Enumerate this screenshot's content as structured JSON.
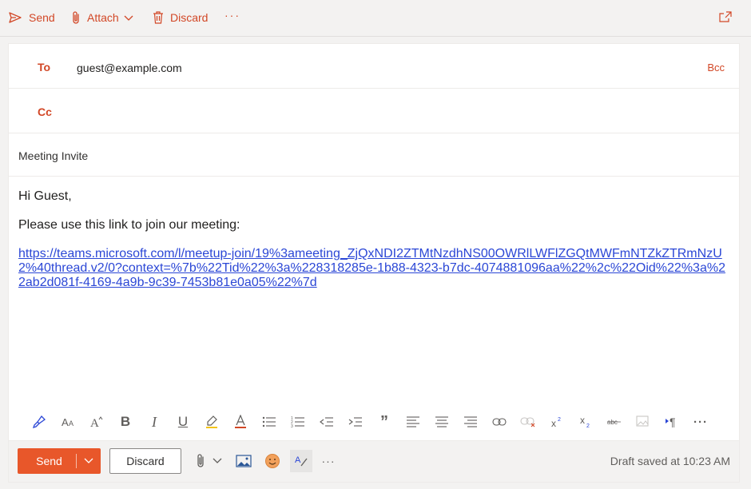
{
  "toolbar": {
    "send_label": "Send",
    "attach_label": "Attach",
    "discard_label": "Discard",
    "more_label": "···"
  },
  "compose": {
    "to_label": "To",
    "to_value": "guest@example.com",
    "bcc_label": "Bcc",
    "cc_label": "Cc",
    "subject": "Meeting Invite",
    "body": {
      "greeting": "Hi Guest,",
      "line": "Please use this link to join our meeting:",
      "link": "https://teams.microsoft.com/l/meetup-join/19%3ameeting_ZjQxNDI2ZTMtNzdhNS00OWRlLWFlZGQtMWFmNTZkZTRmNzU2%40thread.v2/0?context=%7b%22Tid%22%3a%228318285e-1b88-4323-b7dc-4074881096aa%22%2c%22Oid%22%3a%22ab2d081f-4169-4a9b-9c39-7453b81e0a05%22%7d"
    }
  },
  "format_toolbar": {
    "items": [
      "format-painter",
      "font-size",
      "font-size-increase",
      "bold",
      "italic",
      "underline",
      "highlight",
      "font-color",
      "bullets",
      "numbering",
      "decrease-indent",
      "increase-indent",
      "quote",
      "align-left",
      "align-center",
      "align-right",
      "insert-link",
      "remove-link",
      "superscript",
      "subscript",
      "strikethrough",
      "insert-picture",
      "paragraph-direction",
      "more"
    ],
    "labels": {
      "bold": "B",
      "italic": "I",
      "underline": "U",
      "quote": "”",
      "more": "···"
    }
  },
  "bottom": {
    "send_label": "Send",
    "discard_label": "Discard",
    "more_label": "···",
    "draft_status": "Draft saved at 10:23 AM"
  },
  "colors": {
    "accent": "#d24726",
    "send_button": "#e8572a",
    "link": "#2b47d6"
  }
}
